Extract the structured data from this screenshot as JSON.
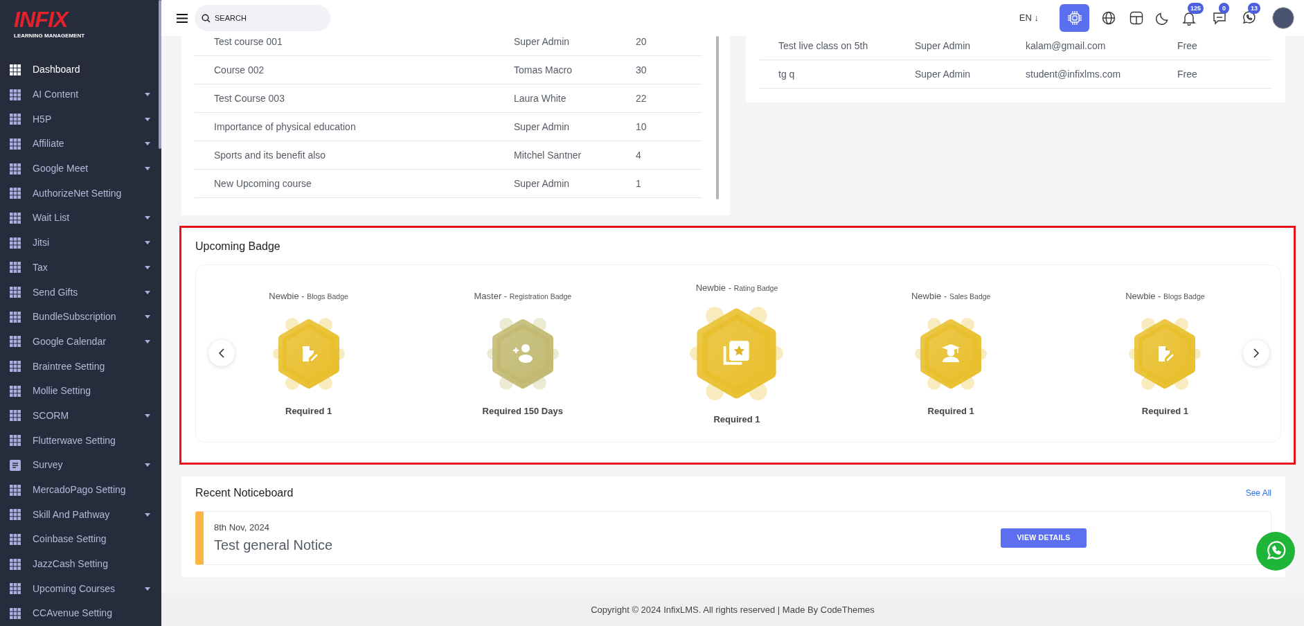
{
  "sidebar": {
    "logo": {
      "brand": "INFIX",
      "subtitle": "LEARNING MANAGEMENT"
    },
    "items": [
      {
        "label": "Dashboard",
        "selected": true,
        "submenu": false,
        "kind": "grid"
      },
      {
        "label": "AI Content",
        "selected": false,
        "submenu": true,
        "kind": "grid"
      },
      {
        "label": "H5P",
        "selected": false,
        "submenu": true,
        "kind": "grid"
      },
      {
        "label": "Affiliate",
        "selected": false,
        "submenu": true,
        "kind": "grid"
      },
      {
        "label": "Google Meet",
        "selected": false,
        "submenu": true,
        "kind": "grid"
      },
      {
        "label": "AuthorizeNet Setting",
        "selected": false,
        "submenu": false,
        "kind": "grid"
      },
      {
        "label": "Wait List",
        "selected": false,
        "submenu": true,
        "kind": "grid"
      },
      {
        "label": "Jitsi",
        "selected": false,
        "submenu": true,
        "kind": "grid"
      },
      {
        "label": "Tax",
        "selected": false,
        "submenu": true,
        "kind": "grid"
      },
      {
        "label": "Send Gifts",
        "selected": false,
        "submenu": true,
        "kind": "grid"
      },
      {
        "label": "BundleSubscription",
        "selected": false,
        "submenu": true,
        "kind": "grid"
      },
      {
        "label": "Google Calendar",
        "selected": false,
        "submenu": true,
        "kind": "grid"
      },
      {
        "label": "Braintree Setting",
        "selected": false,
        "submenu": false,
        "kind": "grid"
      },
      {
        "label": "Mollie Setting",
        "selected": false,
        "submenu": false,
        "kind": "grid"
      },
      {
        "label": "SCORM",
        "selected": false,
        "submenu": true,
        "kind": "grid"
      },
      {
        "label": "Flutterwave Setting",
        "selected": false,
        "submenu": false,
        "kind": "grid"
      },
      {
        "label": "Survey",
        "selected": false,
        "submenu": true,
        "kind": "document"
      },
      {
        "label": "MercadoPago Setting",
        "selected": false,
        "submenu": false,
        "kind": "grid"
      },
      {
        "label": "Skill And Pathway",
        "selected": false,
        "submenu": true,
        "kind": "grid"
      },
      {
        "label": "Coinbase Setting",
        "selected": false,
        "submenu": false,
        "kind": "grid"
      },
      {
        "label": "JazzCash Setting",
        "selected": false,
        "submenu": false,
        "kind": "grid"
      },
      {
        "label": "Upcoming Courses",
        "selected": false,
        "submenu": true,
        "kind": "grid"
      },
      {
        "label": "CCAvenue Setting",
        "selected": false,
        "submenu": false,
        "kind": "grid"
      }
    ]
  },
  "header": {
    "search": {
      "placeholder": "SEARCH"
    },
    "language": "EN ↓",
    "notifications": "125",
    "messages": "0",
    "whatsapp": "13"
  },
  "courses_table": {
    "rows": [
      [
        "Test course 001",
        "Super Admin",
        "20"
      ],
      [
        "Course 002",
        "Tomas Macro",
        "30"
      ],
      [
        "Test Course 003",
        "Laura White",
        "22"
      ],
      [
        "Importance of physical education",
        "Super Admin",
        "10"
      ],
      [
        "Sports and its benefit also",
        "Mitchel Santner",
        "4"
      ],
      [
        "New Upcoming course",
        "Super Admin",
        "1"
      ]
    ]
  },
  "live_classes_table": {
    "rows": [
      [
        "Test live class on 5th",
        "Super Admin",
        "kalam@gmail.com",
        "Free"
      ],
      [
        "tg q",
        "Super Admin",
        "student@infixlms.com",
        "Free"
      ]
    ]
  },
  "upcoming_badge": {
    "title": "Upcoming Badge",
    "highlighted": true,
    "badges": [
      {
        "rank": "Newbie -",
        "category": "Blogs Badge",
        "requirement": "Required 1",
        "featured": false,
        "color": "#e8bf2c"
      },
      {
        "rank": "Master -",
        "category": "Registration Badge",
        "requirement": "Required 150 Days",
        "featured": false,
        "color": "#c2ba72"
      },
      {
        "rank": "Newbie -",
        "category": "Rating Badge",
        "requirement": "Required 1",
        "featured": true,
        "color": "#e8bf2c"
      },
      {
        "rank": "Newbie -",
        "category": "Sales Badge",
        "requirement": "Required 1",
        "featured": false,
        "color": "#e8bf2c"
      },
      {
        "rank": "Newbie -",
        "category": "Blogs Badge",
        "requirement": "Required 1",
        "featured": false,
        "color": "#e8bf2c"
      }
    ]
  },
  "noticeboard": {
    "title": "Recent Noticeboard",
    "see_all": "See All",
    "notices": [
      {
        "date": "8th Nov, 2024",
        "title": "Test general Notice",
        "button": "VIEW DETAILS"
      }
    ]
  },
  "footer": "Copyright © 2024 InfixLMS. All rights reserved | Made By CodeThemes"
}
